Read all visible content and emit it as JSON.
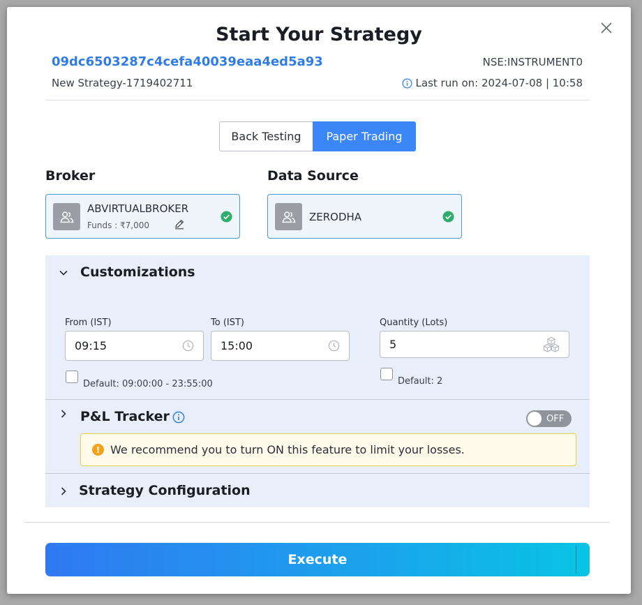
{
  "modal": {
    "title": "Start Your Strategy",
    "strategy_id": "09dc6503287c4cefa40039eaa4ed5a93",
    "strategy_name": "New Strategy-1719402711",
    "instrument": "NSE:INSTRUMENT0",
    "last_run": "Last run on: 2024-07-08 | 10:58"
  },
  "tabs": [
    {
      "label": "Back Testing",
      "active": false
    },
    {
      "label": "Paper Trading",
      "active": true
    }
  ],
  "broker": {
    "heading": "Broker",
    "name": "ABVIRTUALBROKER",
    "funds": "Funds : ₹7,000",
    "verified": true
  },
  "data_source": {
    "heading": "Data Source",
    "name": "ZERODHA",
    "verified": true
  },
  "customizations": {
    "title": "Customizations",
    "expanded": true,
    "from_label": "From (IST)",
    "from_value": "09:15",
    "to_label": "To (IST)",
    "to_value": "15:00",
    "time_default_label": "Default: 09:00:00 - 23:55:00",
    "time_default_checked": false,
    "quantity_label": "Quantity (Lots)",
    "quantity_value": "5",
    "quantity_default_label": "Default: 2",
    "quantity_default_checked": false
  },
  "pnl_tracker": {
    "title": "P&L Tracker",
    "expanded": false,
    "toggle_label": "OFF",
    "toggle_on": false,
    "warning": "We recommend you to turn ON this feature to limit your losses."
  },
  "strategy_configuration": {
    "title": "Strategy Configuration",
    "expanded": false
  },
  "execute_label": "Execute",
  "colors": {
    "accent": "#3a86f7",
    "link": "#2f7be8",
    "success": "#2eae6a",
    "warning": "#f4a21b",
    "panel_bg": "#e8eefa"
  },
  "icons": [
    "close-icon",
    "info-icon",
    "user-icon",
    "edit-icon",
    "check-circle-icon",
    "clock-icon",
    "cubes-icon",
    "chevron-down-icon",
    "chevron-right-icon",
    "warning-icon"
  ]
}
